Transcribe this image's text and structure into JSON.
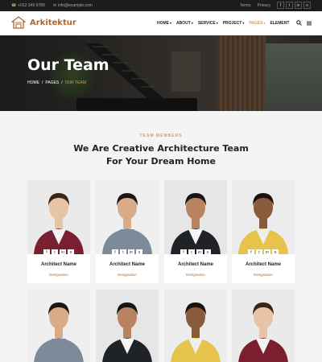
{
  "topbar": {
    "phone": "+012 345 6789",
    "email": "info@example.com",
    "links": [
      "Terms",
      "Privacy"
    ],
    "socials": [
      "f",
      "t",
      "in",
      "o"
    ]
  },
  "header": {
    "logo_text": "Arkitektur",
    "nav": [
      {
        "label": "HOME",
        "caret": "▾"
      },
      {
        "label": "ABOUT",
        "caret": "▾"
      },
      {
        "label": "SERVICE",
        "caret": "▾"
      },
      {
        "label": "PROJECT",
        "caret": "▾"
      },
      {
        "label": "PAGES",
        "caret": "▾"
      },
      {
        "label": "ELEMENT",
        "caret": ""
      }
    ],
    "search_icon": "search-icon",
    "menu_icon": "menu-icon"
  },
  "hero": {
    "title": "Our Team",
    "breadcrumb": [
      "HOME",
      "/",
      "PAGES",
      "/",
      "OUR TEAM"
    ]
  },
  "section": {
    "eyebrow": "TEAM MEMBERS",
    "title_line1": "We Are Creative Architecture Team",
    "title_line2": "For Your Dream Home"
  },
  "team": [
    {
      "name": "Architect Name",
      "role": "Designation",
      "skin": "#e8c4a6",
      "hair": "#3a2618",
      "shirt": "#7a1f2f",
      "inner": "#f4f4f4",
      "bg": "#eaeaea"
    },
    {
      "name": "Architect Name",
      "role": "Designation",
      "skin": "#d9ab87",
      "hair": "#1e1612",
      "shirt": "#7d8a99",
      "inner": "#7d8a99",
      "bg": "#efefef"
    },
    {
      "name": "Architect Name",
      "role": "Designation",
      "skin": "#b98260",
      "hair": "#151515",
      "shirt": "#1f2226",
      "inner": "#f5f5f5",
      "bg": "#e6e6e6"
    },
    {
      "name": "Architect Name",
      "role": "Designation",
      "skin": "#8a5a3c",
      "hair": "#1a120d",
      "shirt": "#e6c34a",
      "inner": "#eeeeee",
      "bg": "#ececec"
    },
    {
      "skin": "#d9ab87",
      "hair": "#1e1612",
      "shirt": "#7d8a99",
      "inner": "#7d8a99",
      "bg": "#efefef"
    },
    {
      "skin": "#b98260",
      "hair": "#151515",
      "shirt": "#1f2226",
      "inner": "#f5f5f5",
      "bg": "#e6e6e6"
    },
    {
      "skin": "#8a5a3c",
      "hair": "#1a120d",
      "shirt": "#e6c34a",
      "inner": "#eeeeee",
      "bg": "#ececec"
    },
    {
      "skin": "#e8c4a6",
      "hair": "#3a2618",
      "shirt": "#7a1f2f",
      "inner": "#f4f4f4",
      "bg": "#eaeaea"
    }
  ],
  "colors": {
    "accent": "#c8a46a",
    "brand": "#a86a3a",
    "dark": "#1c1c1c"
  }
}
